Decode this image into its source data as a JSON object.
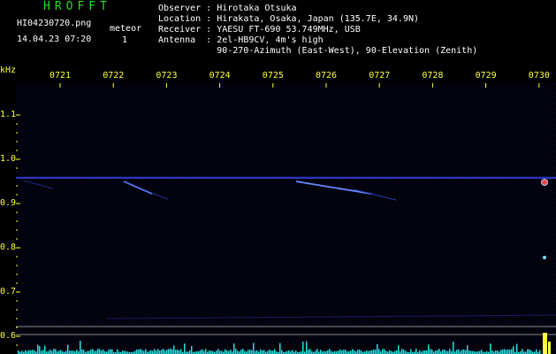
{
  "header": {
    "brand": "HROFFT",
    "filename": "HI04230720.png",
    "timestamp": "14.04.23 07:20",
    "meteor_label": "meteor",
    "meteor_count": "1"
  },
  "info": {
    "observer": "Observer : Hirotaka Otsuka",
    "location": "Location : Hirakata, Osaka, Japan (135.7E, 34.9N)",
    "receiver": "Receiver : YAESU FT-690 53.749MHz, USB",
    "antenna": "Antenna  : 2el-HB9CV, 4m's high",
    "antenna2": "           90-270-Azimuth (East-West), 90-Elevation (Zenith)"
  },
  "axis": {
    "unit": "kHz",
    "x_ticks": [
      "0721",
      "0722",
      "0723",
      "0724",
      "0725",
      "0726",
      "0727",
      "0728",
      "0729",
      "0730"
    ],
    "y_ticks": [
      "1.1",
      "1.0",
      "0.9",
      "0.8",
      "0.7",
      "0.6"
    ]
  },
  "colors": {
    "background": "#000000",
    "label_yellow": "#ffff3a",
    "brand_green": "#20e020",
    "carrier_blue": "#3c4cff",
    "meteor_cyan": "#7fd8ff"
  }
}
